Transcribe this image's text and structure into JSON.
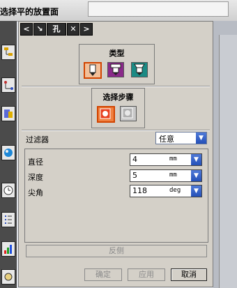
{
  "window": {
    "title": "选择平的放置面"
  },
  "dialog_tabs": [
    "<",
    "↘",
    "孔",
    "✕",
    ">"
  ],
  "type_group": {
    "label": "类型",
    "options": [
      {
        "icon": "simple-hole-icon",
        "active": true
      },
      {
        "icon": "counterbore-hole-icon",
        "active": false
      },
      {
        "icon": "countersink-hole-icon",
        "active": false
      }
    ]
  },
  "select_steps": {
    "label": "选择步骤",
    "options": [
      {
        "icon": "placement-face-icon",
        "active": true
      },
      {
        "icon": "through-face-icon",
        "active": false
      }
    ]
  },
  "filter": {
    "label": "过滤器",
    "value": "任意"
  },
  "params": [
    {
      "label": "直径",
      "value": "4",
      "unit": "mm"
    },
    {
      "label": "深度",
      "value": "5",
      "unit": "mm"
    },
    {
      "label": "尖角",
      "value": "118",
      "unit": "deg"
    }
  ],
  "reverse_button": "反侧",
  "footer": {
    "ok": "确定",
    "apply": "应用",
    "cancel": "取消"
  },
  "colors": {
    "accent": "#2450b8",
    "active_border": "#d24400",
    "toolbar": "#4b4b4b"
  }
}
